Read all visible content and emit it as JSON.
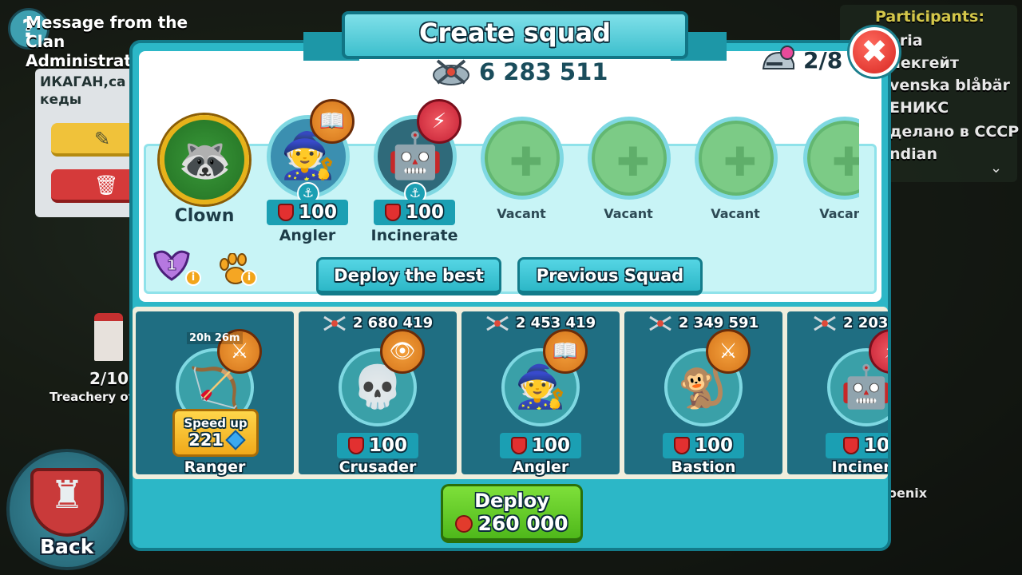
{
  "background": {
    "message_badge": "?",
    "message_title": "Message from the Clan Administration",
    "card_text": "ИКАГАН,са кеды",
    "tower_count": "2/10",
    "tower_label": "Treachery of",
    "back_label": "Back",
    "phoenix_label": "oenix",
    "participants": {
      "title": "Participants:",
      "items": [
        "eria",
        "лекгейт",
        "venska blåbär",
        "ЕНИКС",
        "делано в СССР",
        "ndian"
      ]
    }
  },
  "modal": {
    "title": "Create squad",
    "squad_power": "6 283 511",
    "slots": "2/8",
    "close_label": "✖",
    "leader": {
      "name": "Clown",
      "face": "🦝"
    },
    "squad": [
      {
        "name": "Angler",
        "power": "100",
        "face": "🧙",
        "badge": "📖",
        "badge_color": "orange"
      },
      {
        "name": "Incinerate",
        "power": "100",
        "face": "🤖",
        "badge": "⚡",
        "badge_color": "red"
      }
    ],
    "vacant": [
      "Vacant",
      "Vacant",
      "Vacant",
      "Vacant"
    ],
    "perks": {
      "level_badge": "1",
      "info": "i"
    },
    "buttons": {
      "deploy_best": "Deploy the best",
      "previous_squad": "Previous Squad"
    },
    "available": [
      {
        "name": "Ranger",
        "power": "",
        "face": "🏹",
        "timer": "20h 26m",
        "speed_label": "Speed up",
        "speed_cost": "221",
        "badge": "⚔"
      },
      {
        "name": "Crusader",
        "power": "2 680 419",
        "pill": "100",
        "face": "💀",
        "badge": "👁"
      },
      {
        "name": "Angler",
        "power": "2 453 419",
        "pill": "100",
        "face": "🧙",
        "badge": "📖"
      },
      {
        "name": "Bastion",
        "power": "2 349 591",
        "pill": "100",
        "face": "🐒",
        "badge": "⚔"
      },
      {
        "name": "Incinera",
        "power": "2 203",
        "pill": "10",
        "face": "🤖",
        "badge": "⚡"
      }
    ],
    "deploy": {
      "label": "Deploy",
      "cost": "260 000"
    }
  },
  "colors": {
    "panel": "#2cb7c7",
    "panel_border": "#137b8a",
    "accent_green": "#4fb81b",
    "close_red": "#d82722",
    "badge_orange": "#d5741a"
  }
}
